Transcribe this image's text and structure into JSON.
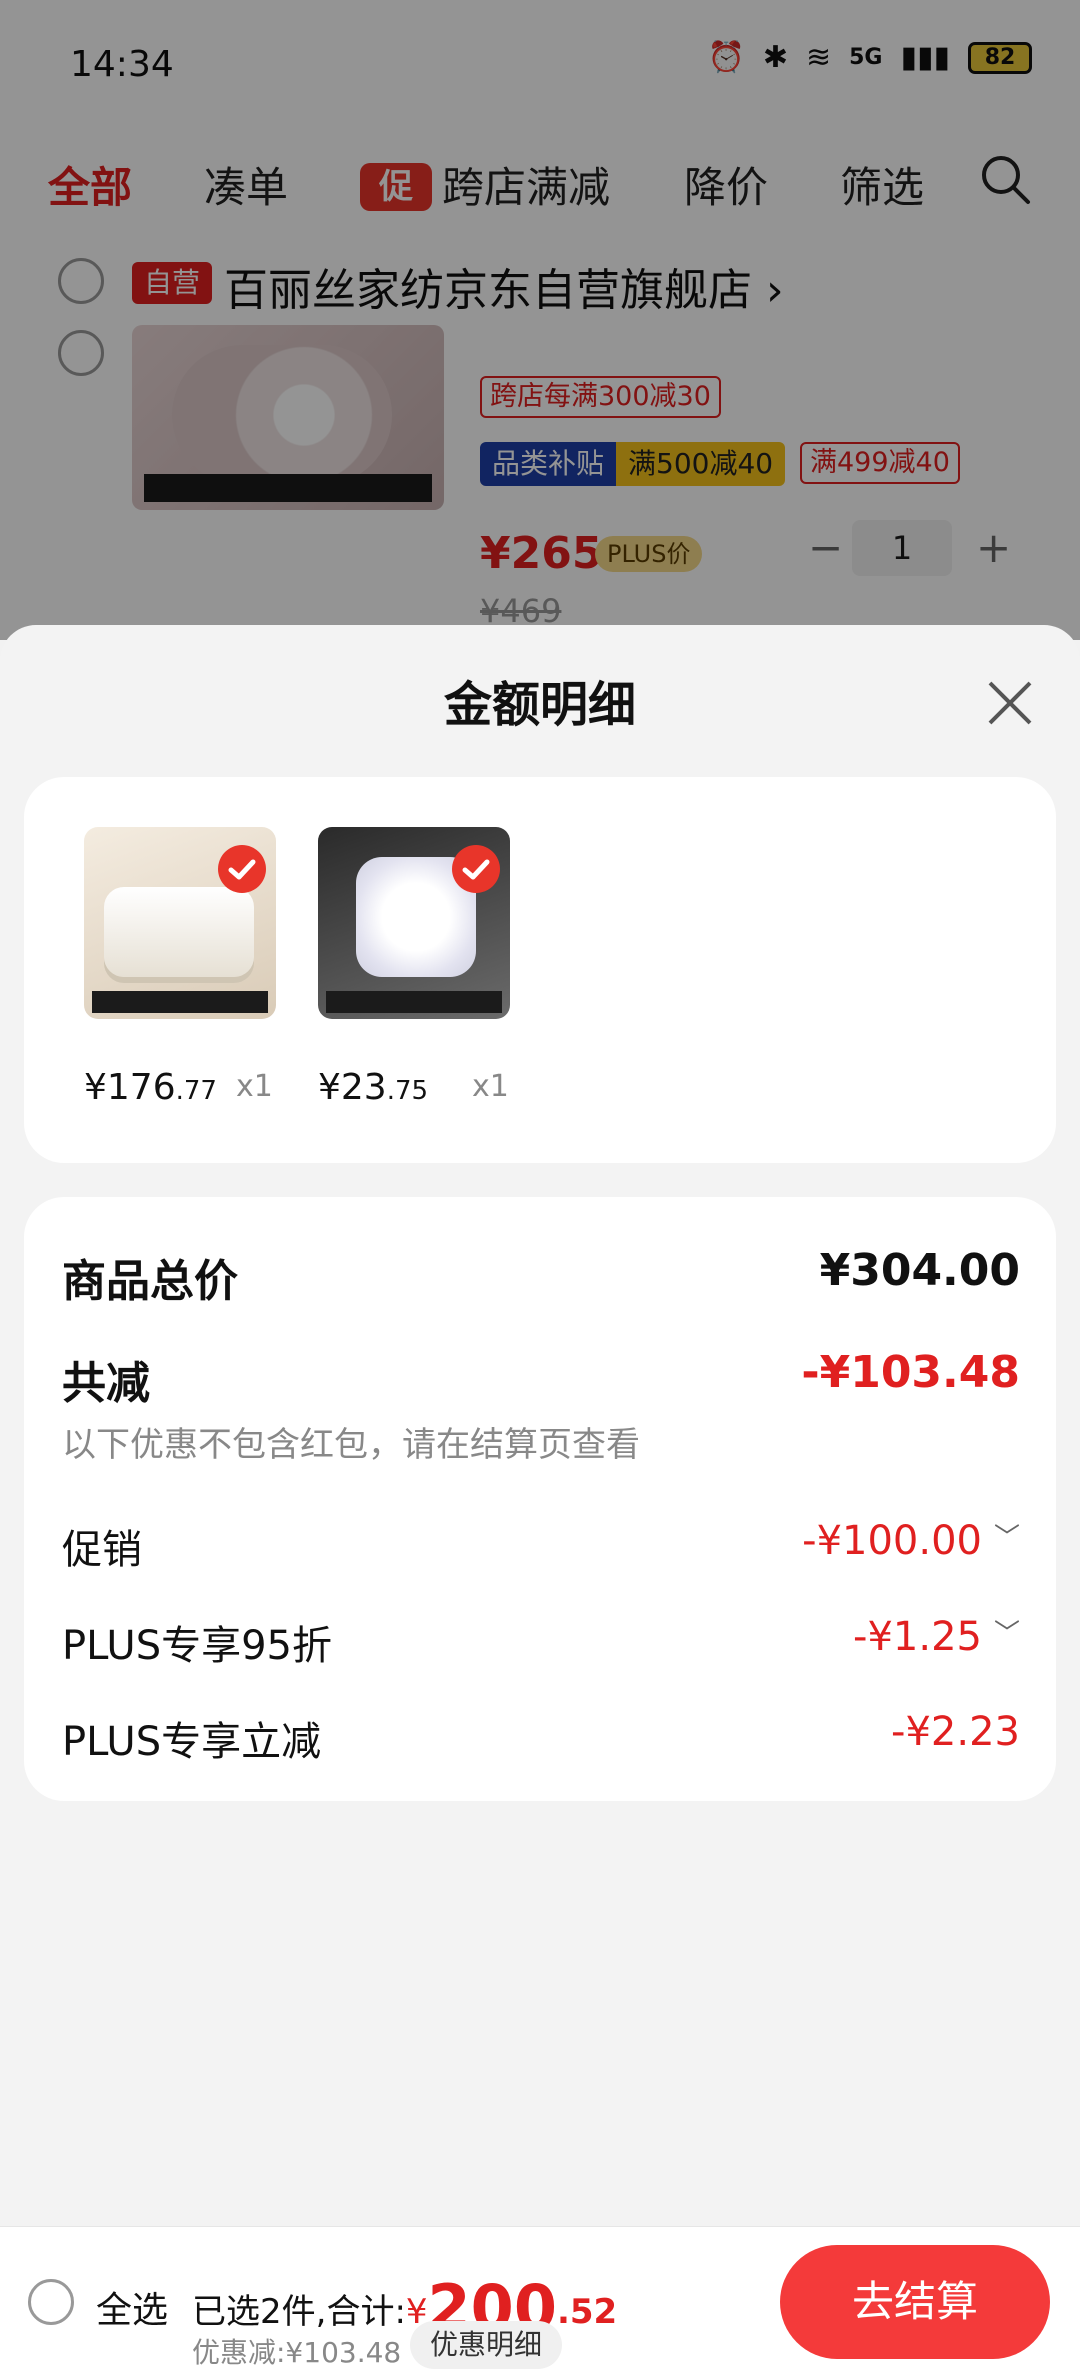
{
  "status_bar": {
    "time": "14:34",
    "network": "5G",
    "battery": "82"
  },
  "top_nav": {
    "tabs": [
      {
        "label": "全部",
        "active": true
      },
      {
        "label": "凑单"
      },
      {
        "badge": "促",
        "label": "跨店满减"
      },
      {
        "label": "降价"
      },
      {
        "label": "筛选"
      }
    ],
    "search_icon": "search-icon"
  },
  "store": {
    "badge": "自营",
    "name": "百丽丝家纺京东自营旗舰店",
    "chevron": "›"
  },
  "background_product": {
    "coupon": "跨店每满300减30",
    "category_tag_a": "品类补贴",
    "category_tag_b": "满500减40",
    "coupon2": "满499减40",
    "price": "¥265",
    "plus_badge": "PLUS价",
    "original_price": "¥469",
    "quantity": "1",
    "minus": "−",
    "plus": "+"
  },
  "sheet": {
    "title": "金额明细",
    "items": [
      {
        "price_main": "¥176",
        "price_dec": ".77",
        "qty": "x1"
      },
      {
        "price_main": "¥23",
        "price_dec": ".75",
        "qty": "x1"
      }
    ],
    "summary": {
      "total_label": "商品总价",
      "total_value": "¥304.00",
      "reduce_label": "共减",
      "reduce_value": "-¥103.48",
      "note": "以下优惠不包含红包，请在结算页查看",
      "rows": [
        {
          "label": "促销",
          "value": "-¥100.00"
        },
        {
          "label": "PLUS专享95折",
          "value": "-¥1.25"
        },
        {
          "label": "PLUS专享立减",
          "value": "-¥2.23"
        }
      ]
    }
  },
  "bottom_bar": {
    "select_all": "全选",
    "selected_prefix": "已选2件,合计:",
    "currency": "¥",
    "total_int": "200",
    "total_dec": ".52",
    "saved": "优惠减:¥103.48",
    "detail_button": "优惠明细",
    "checkout": "去结算"
  },
  "colors": {
    "accent_red": "#e02020",
    "checkout_red": "#f43a3a",
    "sheet_bg": "#f3f3f3"
  }
}
